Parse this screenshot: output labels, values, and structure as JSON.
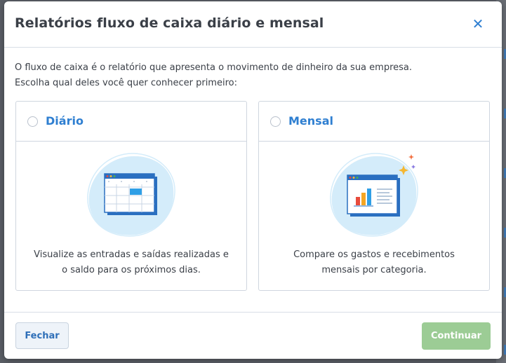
{
  "modal": {
    "title": "Relatórios fluxo de caixa diário e mensal",
    "close_icon": "close-icon",
    "description_line1": "O fluxo de caixa é o relatório que apresenta o movimento de dinheiro da sua empresa.",
    "description_line2": "Escolha qual deles você quer conhecer primeiro:"
  },
  "options": [
    {
      "label": "Diário",
      "selected": false,
      "text_line1": "Visualize as entradas e saídas realizadas e",
      "text_line2": "o saldo para os próximos dias.",
      "illustration_icon": "calendar-window-icon"
    },
    {
      "label": "Mensal",
      "selected": false,
      "text_line1": "Compare os gastos e recebimentos",
      "text_line2": "mensais por categoria.",
      "illustration_icon": "bar-chart-window-icon"
    }
  ],
  "footer": {
    "close_label": "Fechar",
    "continue_label": "Continuar",
    "continue_disabled": true
  },
  "colors": {
    "accent": "#2f7fd1",
    "continue_disabled_bg": "#9ccc95",
    "illustration_bg": "#d4ecfa"
  }
}
